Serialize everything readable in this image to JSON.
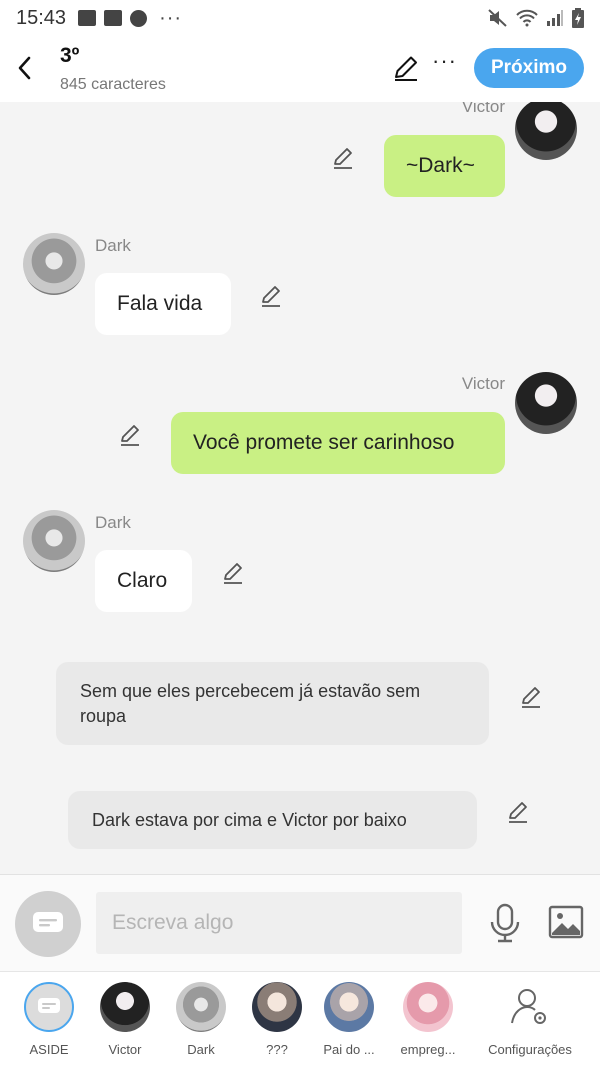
{
  "status_bar": {
    "time": "15:43",
    "overflow": "···"
  },
  "header": {
    "title": "3º",
    "subtitle": "845 caracteres",
    "more": "···",
    "next_label": "Próximo"
  },
  "messages": [
    {
      "type": "message",
      "side": "right",
      "sender": "Victor",
      "text": "~Dark~"
    },
    {
      "type": "message",
      "side": "left",
      "sender": "Dark",
      "text": "Fala vida"
    },
    {
      "type": "message",
      "side": "right",
      "sender": "Victor",
      "text": "Você promete ser carinhoso"
    },
    {
      "type": "message",
      "side": "left",
      "sender": "Dark",
      "text": "Claro"
    },
    {
      "type": "narration",
      "text": "Sem que eles percebecem já estavão sem roupa"
    },
    {
      "type": "narration",
      "text": "Dark estava por cima e Victor por baixo"
    }
  ],
  "composer": {
    "placeholder": "Escreva algo"
  },
  "characters": [
    {
      "label": "ASIDE"
    },
    {
      "label": "Victor"
    },
    {
      "label": "Dark"
    },
    {
      "label": "???"
    },
    {
      "label": "Pai do ..."
    },
    {
      "label": "empreg..."
    },
    {
      "label": "Configurações"
    }
  ],
  "colors": {
    "accent": "#4aa6ee",
    "my_bubble": "#c9f084",
    "other_bubble": "#ffffff",
    "narration_bubble": "#e9e9e9",
    "background": "#f4f4f4"
  },
  "icons": {
    "back": "chevron-left-icon",
    "edit": "pencil-icon",
    "mic": "microphone-icon",
    "image": "image-icon",
    "aside": "chat-bubble-icon",
    "settings": "user-gear-icon"
  }
}
